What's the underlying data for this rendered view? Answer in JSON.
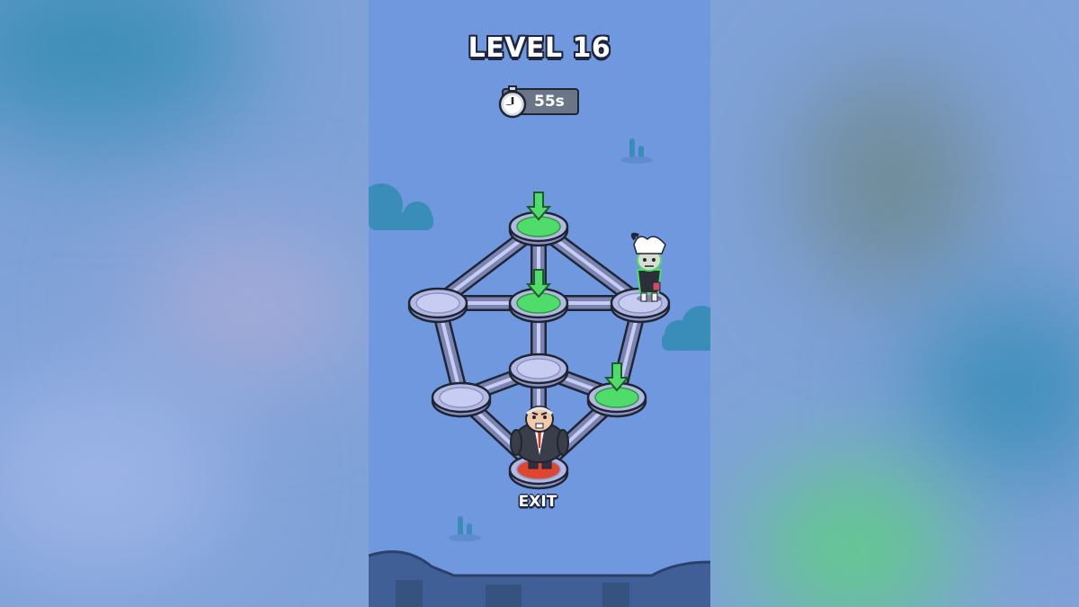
{
  "game": {
    "level_title": "LEVEL 16",
    "timer_text": "55s",
    "exit_label": "EXIT",
    "colors": {
      "sky": "#6f98de",
      "platform": "#c6cdf0",
      "platform_green": "#4fdc6a",
      "exit_pad": "#e0452d",
      "cloud": "#3a8db8",
      "ground": "#3f5f96"
    },
    "nodes": [
      {
        "id": "top",
        "state": "target"
      },
      {
        "id": "mid-left",
        "state": "empty"
      },
      {
        "id": "mid-center",
        "state": "target"
      },
      {
        "id": "mid-right",
        "state": "occupied-zombie"
      },
      {
        "id": "center",
        "state": "empty"
      },
      {
        "id": "lower-left",
        "state": "empty"
      },
      {
        "id": "lower-right",
        "state": "target"
      },
      {
        "id": "exit",
        "state": "exit-boss"
      }
    ],
    "edges": [
      [
        "top",
        "mid-left"
      ],
      [
        "top",
        "mid-center"
      ],
      [
        "top",
        "mid-right"
      ],
      [
        "mid-left",
        "mid-center"
      ],
      [
        "mid-center",
        "mid-right"
      ],
      [
        "mid-left",
        "lower-left"
      ],
      [
        "mid-center",
        "center"
      ],
      [
        "mid-right",
        "lower-right"
      ],
      [
        "center",
        "lower-left"
      ],
      [
        "center",
        "lower-right"
      ],
      [
        "center",
        "exit"
      ],
      [
        "lower-left",
        "exit"
      ],
      [
        "lower-right",
        "exit"
      ]
    ],
    "characters": [
      {
        "name": "zombie",
        "icon": "zombie-character-icon",
        "on_node": "mid-right"
      },
      {
        "name": "boss",
        "icon": "boss-character-icon",
        "on_node": "exit"
      }
    ]
  }
}
